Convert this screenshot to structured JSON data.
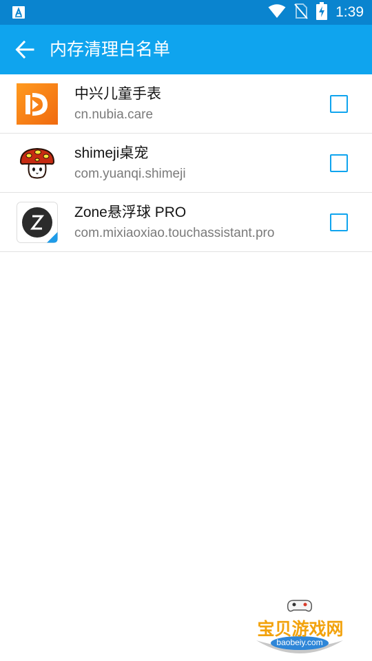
{
  "status_bar": {
    "time": "1:39",
    "left_icon": "a-notification-icon",
    "icons": [
      "wifi-icon",
      "no-sim-icon",
      "battery-charging-icon"
    ]
  },
  "app_bar": {
    "title": "内存清理白名单",
    "back_icon": "arrow-left-icon",
    "color": "#0fa4ee"
  },
  "apps": [
    {
      "name": "中兴儿童手表",
      "package": "cn.nubia.care",
      "checked": false,
      "icon": "nubia-care-icon"
    },
    {
      "name": "shimeji桌宠",
      "package": "com.yuanqi.shimeji",
      "checked": false,
      "icon": "mushroom-icon"
    },
    {
      "name": "Zone悬浮球 PRO",
      "package": "com.mixiaoxiao.touchassistant.pro",
      "checked": false,
      "icon": "zone-icon"
    }
  ],
  "watermark": {
    "text": "宝贝游戏网",
    "url": "baobeiy.com"
  }
}
